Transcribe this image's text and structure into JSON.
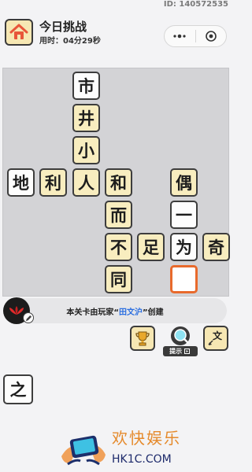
{
  "header": {
    "id_text": "ID: 140572535",
    "title": "今日挑战",
    "timer": "用时：04分29秒"
  },
  "board": {
    "cells": [
      {
        "char": "市",
        "style": "white"
      },
      {
        "char": "井",
        "style": "filled"
      },
      {
        "char": "小",
        "style": "filled"
      },
      {
        "char": "地",
        "style": "white"
      },
      {
        "char": "利",
        "style": "filled"
      },
      {
        "char": "人",
        "style": "filled"
      },
      {
        "char": "和",
        "style": "filled"
      },
      {
        "char": "偶",
        "style": "filled"
      },
      {
        "char": "而",
        "style": "filled"
      },
      {
        "char": "一",
        "style": "white"
      },
      {
        "char": "不",
        "style": "filled"
      },
      {
        "char": "足",
        "style": "filled"
      },
      {
        "char": "为",
        "style": "white"
      },
      {
        "char": "奇",
        "style": "filled"
      },
      {
        "char": "同",
        "style": "filled"
      },
      {
        "char": "",
        "style": "empty"
      }
    ]
  },
  "creator": {
    "prefix": "本关卡由玩家“",
    "name": "田文沪",
    "suffix": "”创建"
  },
  "tools": {
    "hint_label": "提示"
  },
  "candidates": [
    {
      "char": "之"
    }
  ],
  "watermark": {
    "brand": "欢快娱乐",
    "url": "HK1C.COM"
  },
  "colors": {
    "tile_fill": "#f8edbf",
    "selected_border": "#e86a2c",
    "highlight_name": "#2c6fe0"
  }
}
